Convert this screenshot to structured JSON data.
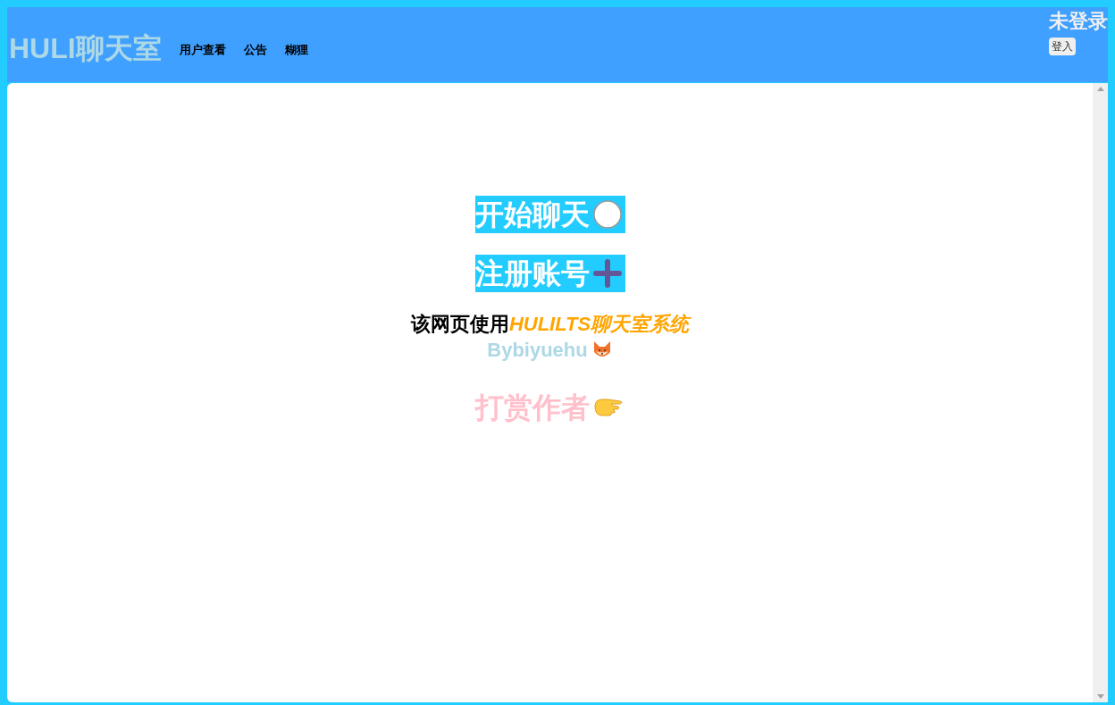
{
  "header": {
    "title": "HULI聊天室",
    "nav": [
      "用户查看",
      "公告",
      "糊狸"
    ],
    "login_status": "未登录",
    "login_button": "登入"
  },
  "main": {
    "actions": [
      {
        "label": "开始聊天",
        "kind": "chat"
      },
      {
        "label": "注册账号",
        "kind": "register"
      }
    ],
    "credit": {
      "text": "该网页使用",
      "highlight": "HULILTS聊天室系统"
    },
    "author": "Bybiyuehu",
    "donate": "打赏作者"
  }
}
